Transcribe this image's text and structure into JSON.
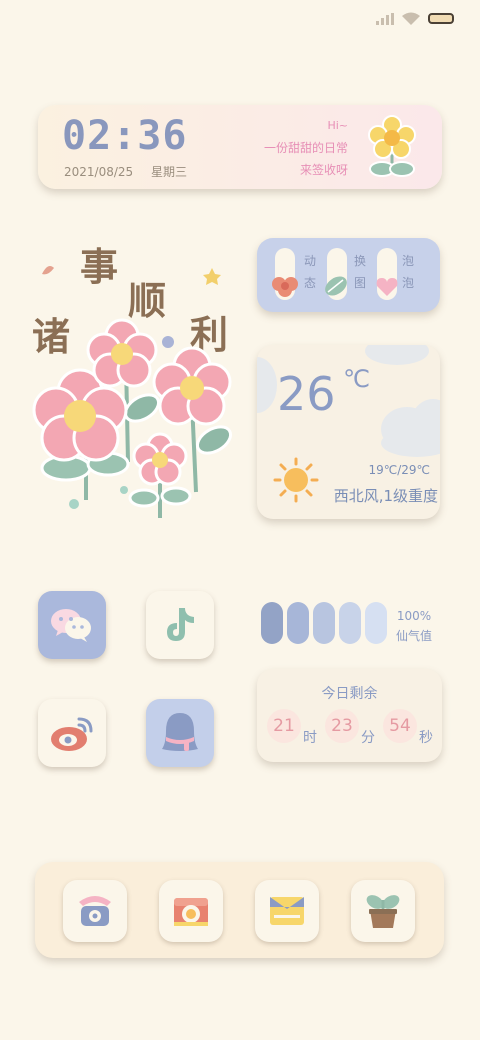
{
  "clock": {
    "time": "02:36",
    "date": "2021/08/25",
    "weekday": "星期三",
    "greeting_hi": "Hi~",
    "greeting_line1": "一份甜甜的日常",
    "greeting_line2": "来签收呀"
  },
  "sticker": {
    "chars": [
      "诸",
      "事",
      "顺",
      "利"
    ]
  },
  "bubbles": {
    "labels": [
      [
        "动",
        "态"
      ],
      [
        "换",
        "图"
      ],
      [
        "泡",
        "泡"
      ]
    ]
  },
  "weather": {
    "temperature": "26",
    "unit": "℃",
    "range": "19℃/29℃",
    "wind": "西北风,1级重度"
  },
  "fairy": {
    "value": "100%",
    "label": "仙气值",
    "level": 1.0
  },
  "countdown": {
    "title": "今日剩余",
    "hours": "21",
    "hours_unit": "时",
    "minutes": "23",
    "minutes_unit": "分",
    "seconds": "54",
    "seconds_unit": "秒"
  },
  "colors": {
    "background": "#fbf6ea",
    "accent_blue": "#8a9bc4",
    "accent_pink": "#e78fb6"
  },
  "apps": [
    "wechat-icon",
    "tiktok-icon",
    "weibo-icon",
    "qq-icon"
  ],
  "dock": [
    "phone-icon",
    "camera-icon",
    "messages-icon",
    "plant-icon"
  ]
}
